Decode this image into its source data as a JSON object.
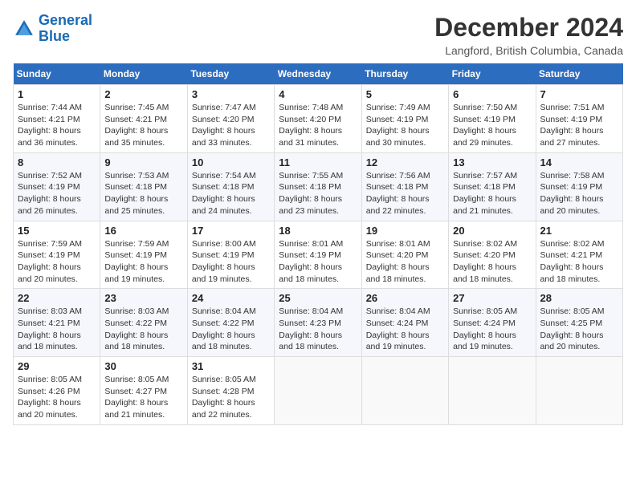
{
  "logo": {
    "line1": "General",
    "line2": "Blue"
  },
  "title": "December 2024",
  "subtitle": "Langford, British Columbia, Canada",
  "weekdays": [
    "Sunday",
    "Monday",
    "Tuesday",
    "Wednesday",
    "Thursday",
    "Friday",
    "Saturday"
  ],
  "weeks": [
    [
      {
        "day": "1",
        "sunrise": "7:44 AM",
        "sunset": "4:21 PM",
        "daylight": "8 hours and 36 minutes."
      },
      {
        "day": "2",
        "sunrise": "7:45 AM",
        "sunset": "4:21 PM",
        "daylight": "8 hours and 35 minutes."
      },
      {
        "day": "3",
        "sunrise": "7:47 AM",
        "sunset": "4:20 PM",
        "daylight": "8 hours and 33 minutes."
      },
      {
        "day": "4",
        "sunrise": "7:48 AM",
        "sunset": "4:20 PM",
        "daylight": "8 hours and 31 minutes."
      },
      {
        "day": "5",
        "sunrise": "7:49 AM",
        "sunset": "4:19 PM",
        "daylight": "8 hours and 30 minutes."
      },
      {
        "day": "6",
        "sunrise": "7:50 AM",
        "sunset": "4:19 PM",
        "daylight": "8 hours and 29 minutes."
      },
      {
        "day": "7",
        "sunrise": "7:51 AM",
        "sunset": "4:19 PM",
        "daylight": "8 hours and 27 minutes."
      }
    ],
    [
      {
        "day": "8",
        "sunrise": "7:52 AM",
        "sunset": "4:19 PM",
        "daylight": "8 hours and 26 minutes."
      },
      {
        "day": "9",
        "sunrise": "7:53 AM",
        "sunset": "4:18 PM",
        "daylight": "8 hours and 25 minutes."
      },
      {
        "day": "10",
        "sunrise": "7:54 AM",
        "sunset": "4:18 PM",
        "daylight": "8 hours and 24 minutes."
      },
      {
        "day": "11",
        "sunrise": "7:55 AM",
        "sunset": "4:18 PM",
        "daylight": "8 hours and 23 minutes."
      },
      {
        "day": "12",
        "sunrise": "7:56 AM",
        "sunset": "4:18 PM",
        "daylight": "8 hours and 22 minutes."
      },
      {
        "day": "13",
        "sunrise": "7:57 AM",
        "sunset": "4:18 PM",
        "daylight": "8 hours and 21 minutes."
      },
      {
        "day": "14",
        "sunrise": "7:58 AM",
        "sunset": "4:19 PM",
        "daylight": "8 hours and 20 minutes."
      }
    ],
    [
      {
        "day": "15",
        "sunrise": "7:59 AM",
        "sunset": "4:19 PM",
        "daylight": "8 hours and 20 minutes."
      },
      {
        "day": "16",
        "sunrise": "7:59 AM",
        "sunset": "4:19 PM",
        "daylight": "8 hours and 19 minutes."
      },
      {
        "day": "17",
        "sunrise": "8:00 AM",
        "sunset": "4:19 PM",
        "daylight": "8 hours and 19 minutes."
      },
      {
        "day": "18",
        "sunrise": "8:01 AM",
        "sunset": "4:19 PM",
        "daylight": "8 hours and 18 minutes."
      },
      {
        "day": "19",
        "sunrise": "8:01 AM",
        "sunset": "4:20 PM",
        "daylight": "8 hours and 18 minutes."
      },
      {
        "day": "20",
        "sunrise": "8:02 AM",
        "sunset": "4:20 PM",
        "daylight": "8 hours and 18 minutes."
      },
      {
        "day": "21",
        "sunrise": "8:02 AM",
        "sunset": "4:21 PM",
        "daylight": "8 hours and 18 minutes."
      }
    ],
    [
      {
        "day": "22",
        "sunrise": "8:03 AM",
        "sunset": "4:21 PM",
        "daylight": "8 hours and 18 minutes."
      },
      {
        "day": "23",
        "sunrise": "8:03 AM",
        "sunset": "4:22 PM",
        "daylight": "8 hours and 18 minutes."
      },
      {
        "day": "24",
        "sunrise": "8:04 AM",
        "sunset": "4:22 PM",
        "daylight": "8 hours and 18 minutes."
      },
      {
        "day": "25",
        "sunrise": "8:04 AM",
        "sunset": "4:23 PM",
        "daylight": "8 hours and 18 minutes."
      },
      {
        "day": "26",
        "sunrise": "8:04 AM",
        "sunset": "4:24 PM",
        "daylight": "8 hours and 19 minutes."
      },
      {
        "day": "27",
        "sunrise": "8:05 AM",
        "sunset": "4:24 PM",
        "daylight": "8 hours and 19 minutes."
      },
      {
        "day": "28",
        "sunrise": "8:05 AM",
        "sunset": "4:25 PM",
        "daylight": "8 hours and 20 minutes."
      }
    ],
    [
      {
        "day": "29",
        "sunrise": "8:05 AM",
        "sunset": "4:26 PM",
        "daylight": "8 hours and 20 minutes."
      },
      {
        "day": "30",
        "sunrise": "8:05 AM",
        "sunset": "4:27 PM",
        "daylight": "8 hours and 21 minutes."
      },
      {
        "day": "31",
        "sunrise": "8:05 AM",
        "sunset": "4:28 PM",
        "daylight": "8 hours and 22 minutes."
      },
      null,
      null,
      null,
      null
    ]
  ]
}
